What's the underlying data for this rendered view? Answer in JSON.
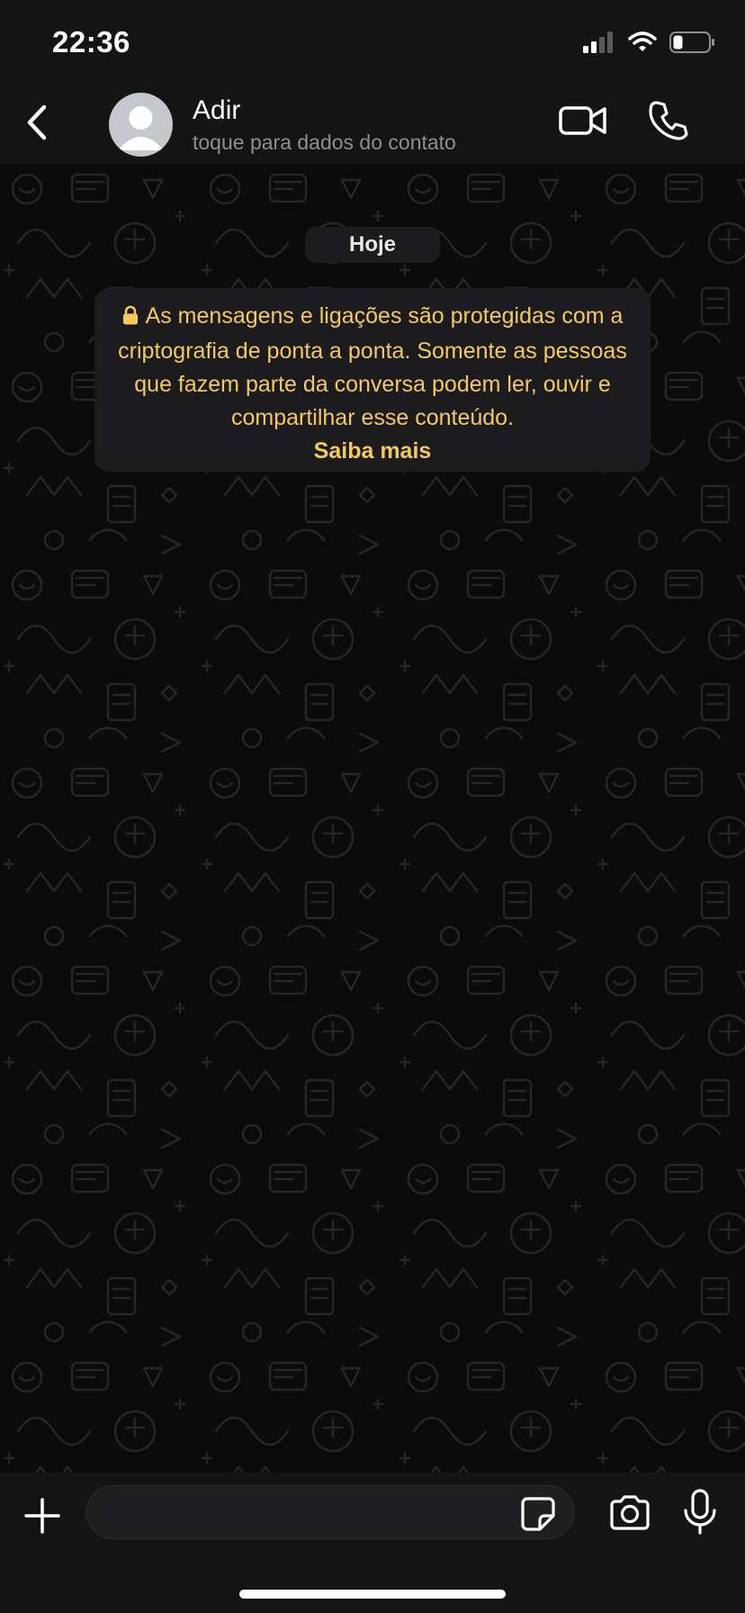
{
  "status_bar": {
    "time": "22:36",
    "icons": [
      "cellular-signal-icon",
      "wifi-icon",
      "battery-icon"
    ]
  },
  "header": {
    "back_icon": "chevron-left-icon",
    "contact_name": "Adir",
    "contact_subtitle": "toque para dados do contato",
    "video_icon": "video-camera-icon",
    "call_icon": "phone-icon"
  },
  "chat": {
    "date_label": "Hoje",
    "encryption_notice": {
      "icon": "lock-icon",
      "text": "As mensagens e ligações são protegidas com a criptografia de ponta a ponta. Somente as pessoas que fazem parte da conversa podem ler, ouvir e compartilhar esse conteúdo.",
      "link_label": "Saiba mais"
    }
  },
  "composer": {
    "plus_icon": "plus-icon",
    "input_value": "",
    "sticker_icon": "sticker-icon",
    "camera_icon": "camera-icon",
    "mic_icon": "microphone-icon"
  },
  "colors": {
    "background": "#0b0b0b",
    "bar_background": "#141414",
    "bubble_background": "#1c1c1e",
    "notice_text": "#f5c95b",
    "subtitle_gray": "#8e8e93"
  }
}
